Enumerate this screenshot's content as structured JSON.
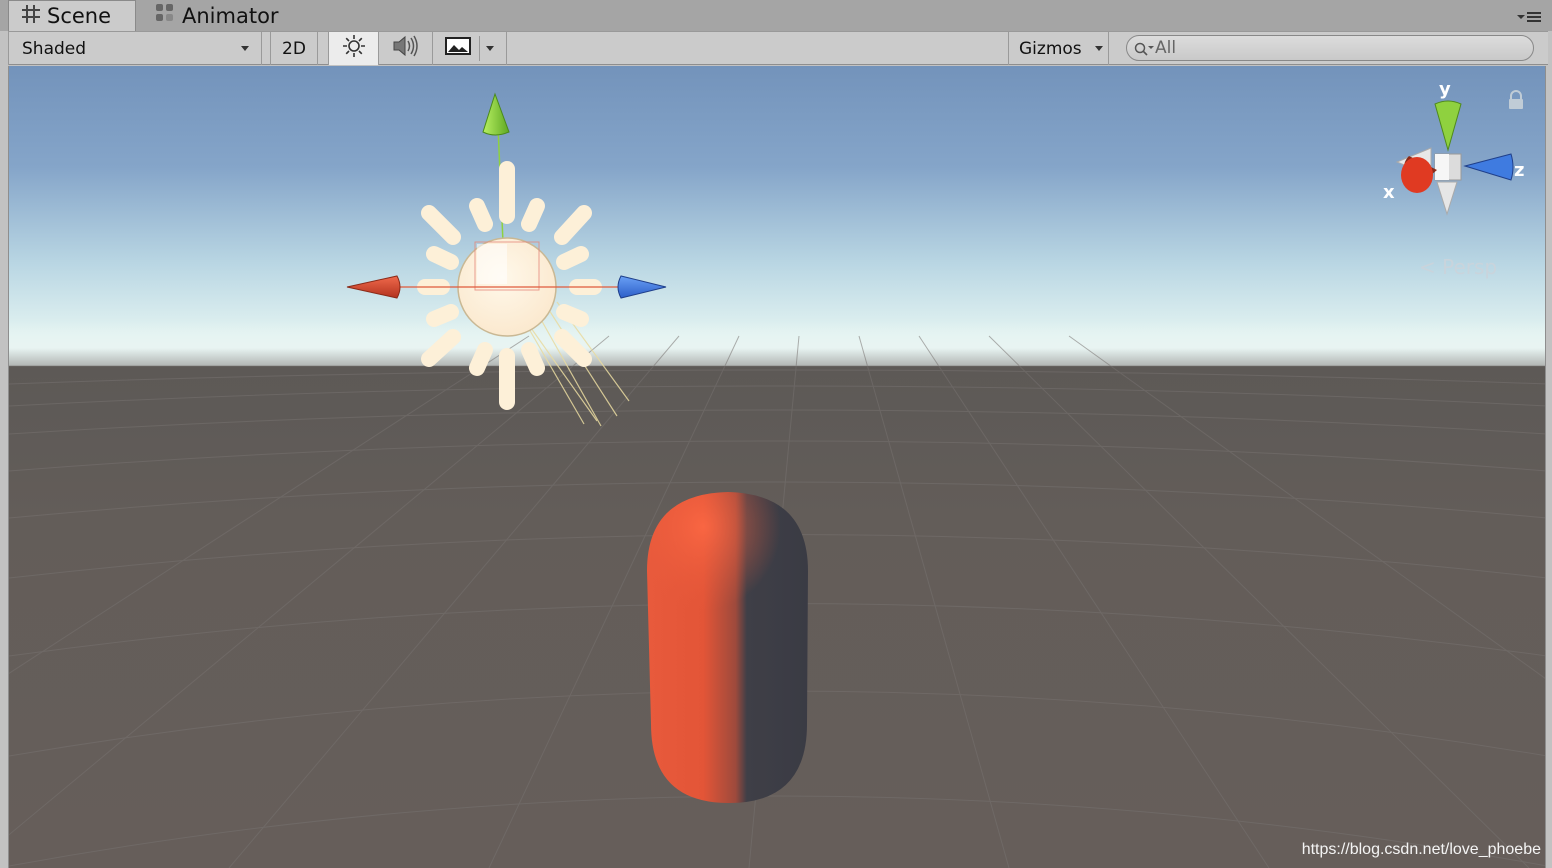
{
  "tabs": [
    {
      "label": "Scene",
      "icon": "grid-hash-icon",
      "active": true
    },
    {
      "label": "Animator",
      "icon": "animator-nodes-icon",
      "active": false
    }
  ],
  "toolbar": {
    "shading_mode": "Shaded",
    "mode_2d_label": "2D",
    "lighting_icon": "sun-icon",
    "audio_icon": "speaker-icon",
    "effects_icon": "image-effects-icon",
    "gizmos_label": "Gizmos",
    "search_value": "All"
  },
  "viewport": {
    "projection_label": "Persp",
    "axis_labels": {
      "x": "x",
      "y": "y",
      "z": "z"
    },
    "objects": [
      "directional-light",
      "capsule"
    ],
    "capsule_color": "#e85b3c",
    "light_color": "#fdf0d8"
  },
  "watermark": "https://blog.csdn.net/love_phoebe",
  "colors": {
    "axis_x": "#d9412a",
    "axis_y": "#8fd13f",
    "axis_z": "#3f7be0",
    "toolbar_bg": "#cbcbcb"
  }
}
